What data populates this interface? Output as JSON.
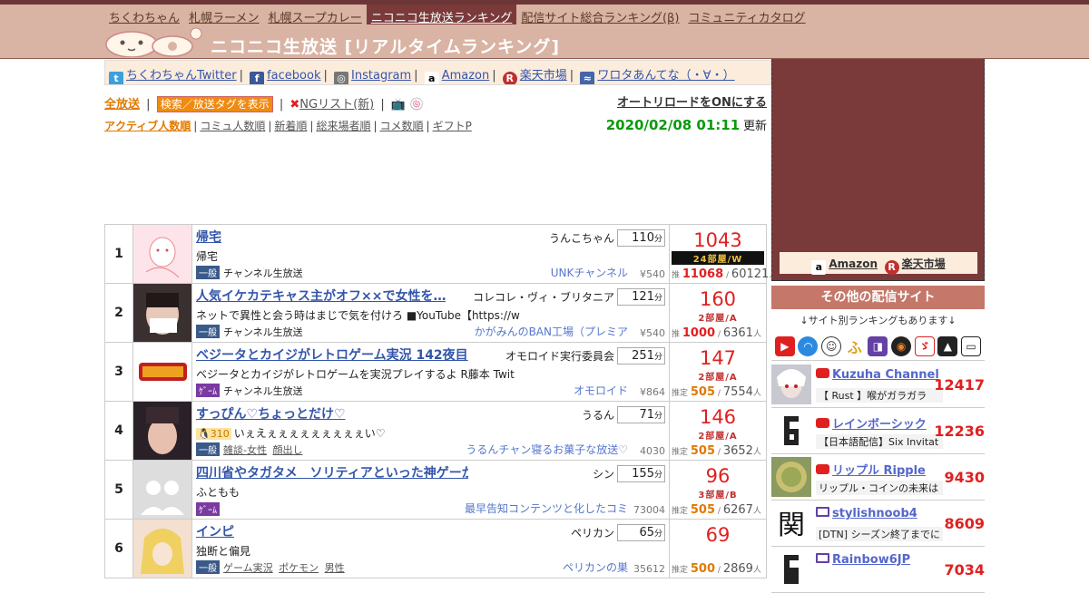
{
  "nav": {
    "items": [
      "ちくわちゃん",
      "札幌ラーメン",
      "札幌スープカレー",
      "ニコニコ生放送ランキング",
      "配信サイト総合ランキング(β)",
      "コミュニティカタログ"
    ],
    "active_index": 3
  },
  "site_title": "ニコニコ生放送 [リアルタイムランキング]",
  "links": {
    "twitter": "ちくわちゃんTwitter",
    "facebook": "facebook",
    "instagram": "Instagram",
    "amazon": "Amazon",
    "rakuten": "楽天市場",
    "wolota": "ワロタあんてな（・∀・）",
    "separator": "|"
  },
  "filters": {
    "all": "全放送",
    "search_tags": "検索／放送タグを表示",
    "ng_list": "NGリスト(新)",
    "autoload": "オートリロードをONにする"
  },
  "sort": {
    "options": [
      "アクティブ人数順",
      "コミュ人数順",
      "新着順",
      "総来場者順",
      "コメ数順",
      "ギフトP"
    ],
    "active_index": 0,
    "datetime": "2020/02/08 01:11",
    "updated_label": "更新"
  },
  "labels": {
    "minutes_unit": "分",
    "estimate": "推定",
    "persons": "人",
    "slash": "/"
  },
  "rankings": [
    {
      "rank": "1",
      "title": "帰宅",
      "owner": "うんこちゃん",
      "minutes": "110",
      "desc": "帰宅",
      "level": "",
      "tags": [
        {
          "label": "一般",
          "color": "blue"
        }
      ],
      "subtags": [
        "チャンネル生放送"
      ],
      "channel": "UNKチャンネル",
      "price": "¥540",
      "active": "1043",
      "room": "24部屋/W",
      "room_style": "dark",
      "est_label": "推",
      "visitors": "11068",
      "visitors_red": true,
      "total": "60121"
    },
    {
      "rank": "2",
      "title": "人気イケカテキャス主がオフ××で女性を…",
      "owner": "コレコレ・ヴィ・ブリタニア",
      "minutes": "121",
      "desc": "ネットで異性と会う時はまじで気を付けろ ■YouTube【https://w",
      "level": "",
      "tags": [
        {
          "label": "一般",
          "color": "blue"
        }
      ],
      "subtags": [
        "チャンネル生放送"
      ],
      "channel": "かがみんのBAN工場（プレミア",
      "price": "¥540",
      "active": "160",
      "room": "2部屋/A",
      "room_style": "red",
      "est_label": "推",
      "visitors": "1000",
      "visitors_red": true,
      "total": "6361"
    },
    {
      "rank": "3",
      "title": "ベジータとカイジがレトロゲーム実況 142夜目",
      "owner": "オモロイド実行委員会",
      "minutes": "251",
      "desc": "ベジータとカイジがレトロゲームを実況プレイするよ R藤本 Twit",
      "level": "",
      "tags": [
        {
          "label": "ｹﾞｰﾑ",
          "color": "purple"
        }
      ],
      "subtags": [
        "チャンネル生放送"
      ],
      "channel": "オモロイド",
      "price": "¥864",
      "active": "147",
      "room": "2部屋/A",
      "room_style": "red",
      "est_label": "推定",
      "visitors": "505",
      "visitors_red": false,
      "total": "7554"
    },
    {
      "rank": "4",
      "title": "すっぴん♡ちょっとだけ♡",
      "owner": "うるん",
      "minutes": "71",
      "desc": "いぇえぇぇぇぇぇぇぇぇぇい♡",
      "level": "310",
      "tags": [
        {
          "label": "一般",
          "color": "blue"
        }
      ],
      "subtags": [
        "雑談-女性",
        "顔出し"
      ],
      "channel": "うるんチャン寝るお菓子な放送♡",
      "price": "4030",
      "active": "146",
      "room": "2部屋/A",
      "room_style": "red",
      "est_label": "推定",
      "visitors": "505",
      "visitors_red": false,
      "total": "3652"
    },
    {
      "rank": "5",
      "title": "四川省やタガタメ　ソリティアといった神ゲーが集う枠",
      "owner": "シン",
      "minutes": "155",
      "desc": "ふともも",
      "level": "",
      "tags": [
        {
          "label": "ｹﾞｰﾑ",
          "color": "purple"
        }
      ],
      "subtags": [],
      "channel": "最早告知コンテンツと化したコミ",
      "price": "73004",
      "active": "96",
      "room": "3部屋/B",
      "room_style": "red",
      "est_label": "推定",
      "visitors": "505",
      "visitors_red": false,
      "total": "6267"
    },
    {
      "rank": "6",
      "title": "インピ",
      "owner": "ペリカン",
      "minutes": "65",
      "desc": "独断と偏見",
      "level": "",
      "tags": [
        {
          "label": "一般",
          "color": "blue"
        }
      ],
      "subtags": [
        "ゲーム実況",
        "ポケモン",
        "男性"
      ],
      "channel": "ペリカンの巣",
      "price": "35612",
      "active": "69",
      "room": "",
      "room_style": "red",
      "est_label": "推定",
      "visitors": "500",
      "visitors_red": false,
      "total": "2869"
    }
  ],
  "sidebar": {
    "ad_amazon": "Amazon",
    "ad_rakuten": "楽天市場",
    "heading": "その他の配信サイト",
    "note": "↓サイト別ランキングもあります↓",
    "streamers": [
      {
        "name": "Kuzuha Channel",
        "platform": "youtube",
        "desc": "【 Rust 】喉がガラガラ",
        "count": "12417"
      },
      {
        "name": "レインボーシック",
        "platform": "youtube",
        "desc": "【日本語配信】Six Invitat",
        "count": "12236"
      },
      {
        "name": "リップル Ripple",
        "platform": "youtube",
        "desc": "リップル・コインの未来は",
        "count": "9430"
      },
      {
        "name": "stylishnoob4",
        "platform": "twitch",
        "desc": "[DTN] シーズン終了までに",
        "count": "8609"
      },
      {
        "name": "Rainbow6JP",
        "platform": "twitch",
        "desc": "",
        "count": "7034"
      }
    ]
  },
  "colors": {
    "header": "#d9b3a3",
    "accent": "#7a3a3a",
    "link": "#3355aa",
    "rank_red": "#e02020",
    "orange": "#e07a00",
    "date_green": "#0a9a0a"
  }
}
